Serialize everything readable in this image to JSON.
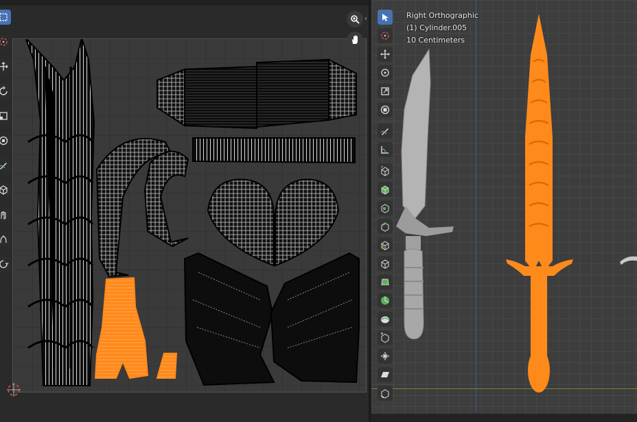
{
  "viewport": {
    "view_name": "Right Orthographic",
    "object_name": "(1) Cylinder.005",
    "grid_scale": "10 Centimeters"
  },
  "colors": {
    "selection": "#ff8a1c",
    "mesh": "#b9b9b9",
    "active_tool": "#4772b3"
  },
  "uv_editor": {
    "tools": [
      "select-box-icon",
      "cursor-icon",
      "move-icon",
      "rotate-icon",
      "scale-icon",
      "transform-icon",
      "annotate-icon",
      "grab-icon",
      "pinch-icon",
      "relax-icon",
      "rip-icon"
    ],
    "nav": [
      "zoom-icon",
      "pan-hand-icon"
    ]
  },
  "viewport_tools": [
    "select-box-icon",
    "cursor-icon",
    "move-icon",
    "rotate-icon",
    "scale-icon",
    "transform-icon",
    "annotate-icon",
    "measure-icon",
    "add-cube-icon",
    "extrude-icon",
    "inset-icon",
    "bevel-icon",
    "loop-cut-icon",
    "knife-icon",
    "poly-build-icon",
    "spin-icon",
    "smooth-icon",
    "edge-slide-icon",
    "shrink-fatten-icon",
    "shear-icon",
    "rip-region-icon"
  ]
}
